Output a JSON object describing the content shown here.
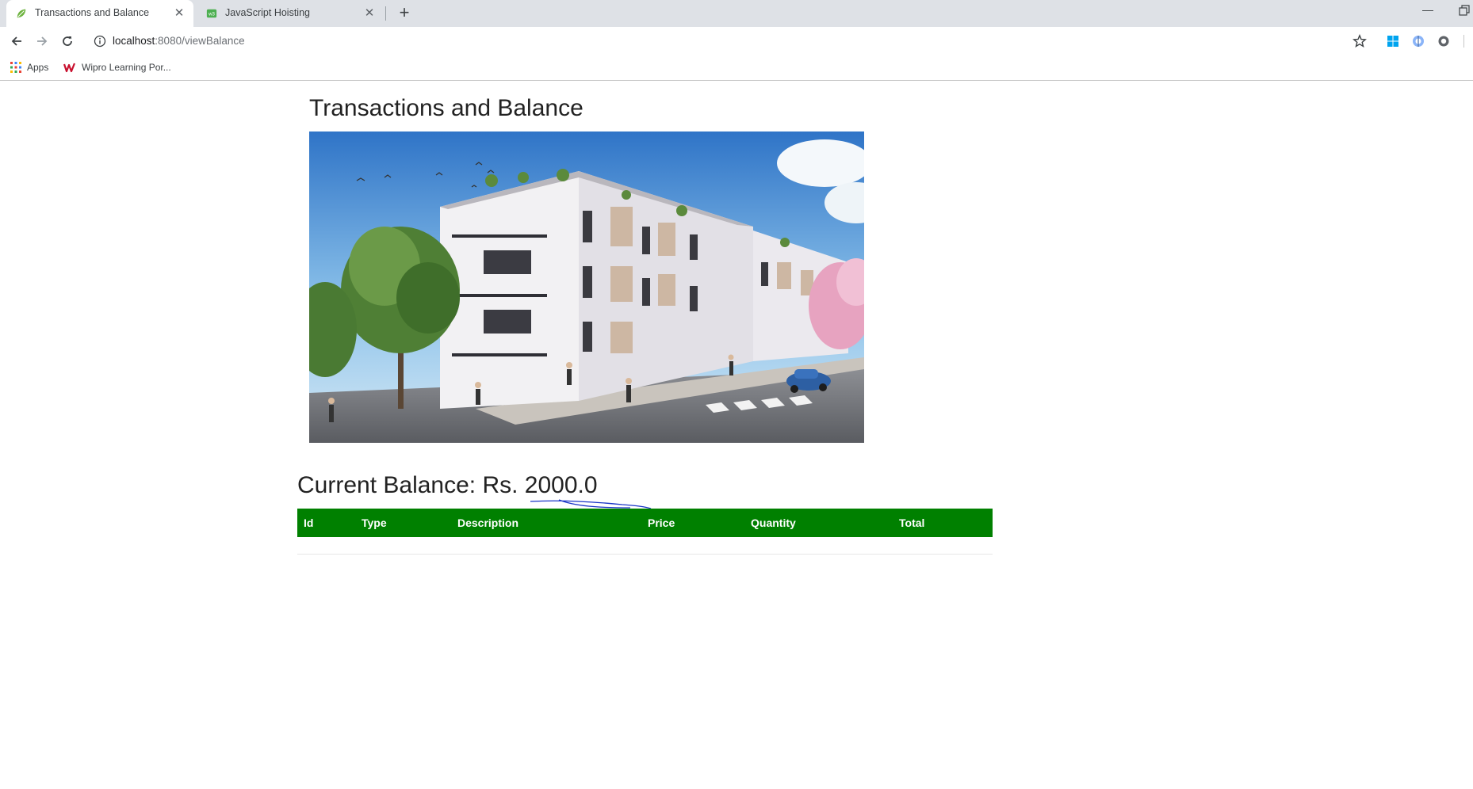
{
  "browser": {
    "tabs": [
      {
        "title": "Transactions and Balance",
        "active": true,
        "icon": "spring-leaf-icon"
      },
      {
        "title": "JavaScript Hoisting",
        "active": false,
        "icon": "site-favicon-icon"
      }
    ],
    "address": {
      "host": "localhost",
      "path": ":8080/viewBalance"
    },
    "bookmarks": [
      {
        "label": "Apps",
        "icon": "apps-grid-icon"
      },
      {
        "label": "Wipro Learning Por...",
        "icon": "wipro-logo-icon"
      }
    ]
  },
  "page": {
    "title": "Transactions and Balance",
    "hero_image": "apartment-building-photo",
    "balance_text": "Current Balance: Rs. 2000.0",
    "table": {
      "headers": [
        "Id",
        "Type",
        "Description",
        "Price",
        "Quantity",
        "Total"
      ],
      "rows": []
    }
  },
  "colors": {
    "table_header_bg": "#008000",
    "tabstrip_bg": "#dee1e6",
    "annotation_ink": "#1a35c7"
  }
}
